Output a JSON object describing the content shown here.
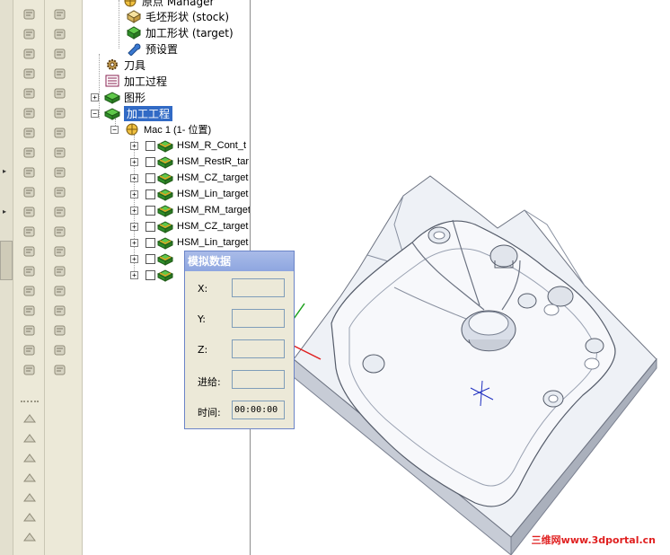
{
  "tree": {
    "items": [
      {
        "label": "原点 Manager",
        "icon": "origin-icon"
      },
      {
        "label": "毛坯形状 (stock)",
        "icon": "stock-box-icon"
      },
      {
        "label": "加工形状 (target)",
        "icon": "target-shape-icon"
      },
      {
        "label": "预设置",
        "icon": "wrench-icon"
      },
      {
        "label": "刀具",
        "icon": "gear-tool-icon"
      },
      {
        "label": "加工过程",
        "icon": "process-list-icon"
      },
      {
        "label": "图形",
        "icon": "part-icon",
        "expander": "+"
      },
      {
        "label": "加工工程",
        "icon": "part-icon",
        "expander": "−",
        "selected": true
      },
      {
        "label": "Mac 1 (1- 位置)",
        "icon": "machine-origin-icon",
        "expander": "−"
      }
    ],
    "operations": [
      "HSM_R_Cont_t",
      "HSM_RestR_tar",
      "HSM_CZ_target",
      "HSM_Lin_target",
      "HSM_RM_target",
      "HSM_CZ_target",
      "HSM_Lin_target",
      "",
      ""
    ]
  },
  "dialog": {
    "title": "模拟数据",
    "fields": [
      {
        "label": "X:",
        "value": ""
      },
      {
        "label": "Y:",
        "value": ""
      },
      {
        "label": "Z:",
        "value": ""
      },
      {
        "label": "进给:",
        "value": ""
      },
      {
        "label": "时间:",
        "value": "00:00:00"
      }
    ]
  },
  "watermark": "三维网www.3dportal.cn",
  "colors": {
    "selection": "#316ac5",
    "dialog_title": "#8ea6e0",
    "part_face": "#eaeef4",
    "watermark": "#e02020"
  }
}
